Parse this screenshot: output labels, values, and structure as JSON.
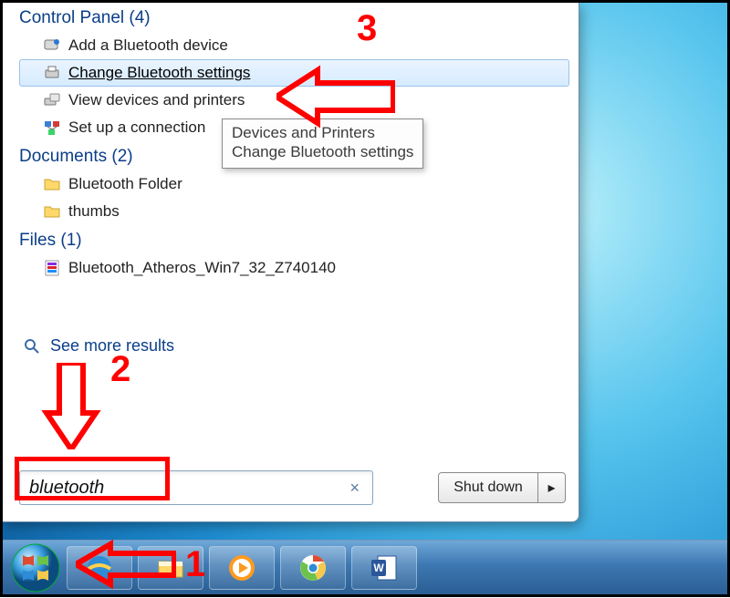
{
  "groups": {
    "control_panel": {
      "header": "Control Panel (4)",
      "items": [
        {
          "label": "Add a Bluetooth device",
          "icon": "bluetooth-device-icon",
          "selected": false
        },
        {
          "label": "Change Bluetooth settings",
          "icon": "printer-icon",
          "selected": true
        },
        {
          "label": "View devices and printers",
          "icon": "devices-printers-icon",
          "selected": false
        },
        {
          "label": "Set up a connection",
          "icon": "network-icon",
          "selected": false
        }
      ]
    },
    "documents": {
      "header": "Documents (2)",
      "items": [
        {
          "label": "Bluetooth Folder",
          "icon": "folder-icon"
        },
        {
          "label": "thumbs",
          "icon": "folder-icon"
        }
      ]
    },
    "files": {
      "header": "Files (1)",
      "items": [
        {
          "label": "Bluetooth_Atheros_Win7_32_Z740140",
          "icon": "archive-icon"
        }
      ]
    }
  },
  "tooltip": {
    "line1": "Devices and Printers",
    "line2": "Change Bluetooth settings"
  },
  "see_more": "See more results",
  "search": {
    "value": "bluetooth",
    "clear": "×"
  },
  "shutdown": {
    "label": "Shut down",
    "arrow": "▸"
  },
  "annotations": {
    "n1": "1",
    "n2": "2",
    "n3": "3"
  },
  "taskbar": {
    "items": [
      "start",
      "ie",
      "explorer",
      "wmp",
      "chrome",
      "word"
    ]
  }
}
